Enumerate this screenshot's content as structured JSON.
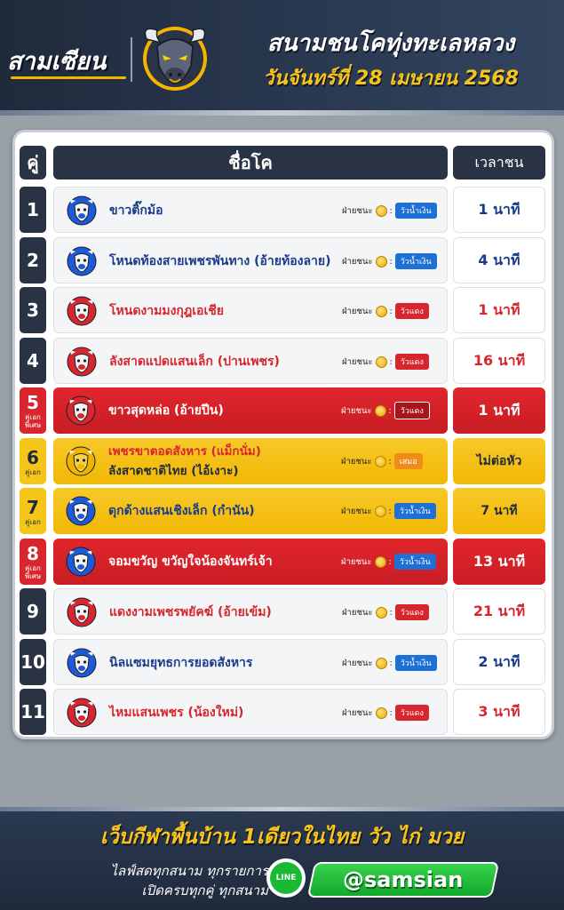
{
  "brand": {
    "logo_text": "สามเซียน"
  },
  "header": {
    "title": "สนามชนโคทุ่งทะเลหลวง",
    "date": "วันจันทร์ที่ 28 เมษายน 2568"
  },
  "table": {
    "headers": {
      "num": "คู่",
      "name": "ชื่อโค",
      "time": "เวลาชน"
    },
    "winner_label": "ฝ่ายชนะ",
    "colon": ":",
    "rows": [
      {
        "num": "1",
        "sub": "",
        "style": "normal",
        "bull": "blue",
        "name": "ขาวติ๊กม้อ",
        "name2": "",
        "name_color": "blue",
        "result": "วัวน้ำเงิน",
        "result_color": "blue",
        "time": "1 นาที",
        "time_color": "blue"
      },
      {
        "num": "2",
        "sub": "",
        "style": "normal",
        "bull": "blue",
        "name": "โหนดท้องสายเพชรพันทาง (อ้ายท้องลาย)",
        "name2": "",
        "name_color": "blue",
        "result": "วัวน้ำเงิน",
        "result_color": "blue",
        "time": "4 นาที",
        "time_color": "blue"
      },
      {
        "num": "3",
        "sub": "",
        "style": "normal",
        "bull": "red",
        "name": "โหนดงามมงกุฎเอเชีย",
        "name2": "",
        "name_color": "red",
        "result": "วัวแดง",
        "result_color": "red",
        "time": "1 นาที",
        "time_color": "red"
      },
      {
        "num": "4",
        "sub": "",
        "style": "normal",
        "bull": "red",
        "name": "ลังสาดแปดแสนเล็ก (ปานเพชร)",
        "name2": "",
        "name_color": "red",
        "result": "วัวแดง",
        "result_color": "red",
        "time": "16 นาที",
        "time_color": "red"
      },
      {
        "num": "5",
        "sub": "คู่เอก พิเศษ",
        "style": "red",
        "bull": "red",
        "name": "ขาวสุดหล่อ (อ้ายปีน)",
        "name2": "",
        "name_color": "white",
        "result": "วัวแดง",
        "result_color": "red",
        "time": "1 นาที",
        "time_color": "white"
      },
      {
        "num": "6",
        "sub": "คู่เอก",
        "style": "yellow",
        "bull": "gold",
        "name": "เพชรขาตอดสังหาร (แม็กนั่ม)",
        "name2": "ลังสาดชาติไทย (ไอ้เงาะ)",
        "name_color": "two",
        "result": "เสมอ",
        "result_color": "draw",
        "time": "ไม่ต่อหัว",
        "time_color": "dark"
      },
      {
        "num": "7",
        "sub": "คู่เอก",
        "style": "yellow",
        "bull": "blue",
        "name": "ดุกด้างแสนเชิงเล็ก (กำนัน)",
        "name2": "",
        "name_color": "blue",
        "result": "วัวน้ำเงิน",
        "result_color": "blue",
        "time": "7 นาที",
        "time_color": "dark"
      },
      {
        "num": "8",
        "sub": "คู่เอก พิเศษ",
        "style": "red",
        "bull": "blue",
        "name": "จอมขวัญ ขวัญใจน้องจันทร์เจ้า",
        "name2": "",
        "name_color": "white",
        "result": "วัวน้ำเงิน",
        "result_color": "blue",
        "time": "13 นาที",
        "time_color": "white"
      },
      {
        "num": "9",
        "sub": "",
        "style": "normal",
        "bull": "red",
        "name": "แดงงามเพชรพยัคฆ์ (อ้ายเข้ม)",
        "name2": "",
        "name_color": "red",
        "result": "วัวแดง",
        "result_color": "red",
        "time": "21 นาที",
        "time_color": "red"
      },
      {
        "num": "10",
        "sub": "",
        "style": "normal",
        "bull": "blue",
        "name": "นิลแซมยุทธการยอดสังหาร",
        "name2": "",
        "name_color": "blue",
        "result": "วัวน้ำเงิน",
        "result_color": "blue",
        "time": "2 นาที",
        "time_color": "blue"
      },
      {
        "num": "11",
        "sub": "",
        "style": "normal",
        "bull": "red",
        "name": "ไหมแสนเพชร (น้องใหม่)",
        "name2": "",
        "name_color": "red",
        "result": "วัวแดง",
        "result_color": "red",
        "time": "3 นาที",
        "time_color": "red"
      }
    ]
  },
  "footer": {
    "slogan": "เว็บกีฬาพื้นบ้าน 1เดียวในไทย วัว ไก่ มวย",
    "tagline1": "ไลฟ์สดทุกสนาม ทุกรายการ",
    "tagline2": "เปิดครบทุกคู่ ทุกสนาม",
    "line_icon_label": "LINE",
    "line_id": "@samsian"
  },
  "colors": {
    "navy": "#2a3344",
    "red": "#d7262d",
    "blue": "#1a3b8c",
    "badge_blue": "#1e6fd6",
    "yellow": "#f5c518",
    "line_green": "#19b934"
  }
}
